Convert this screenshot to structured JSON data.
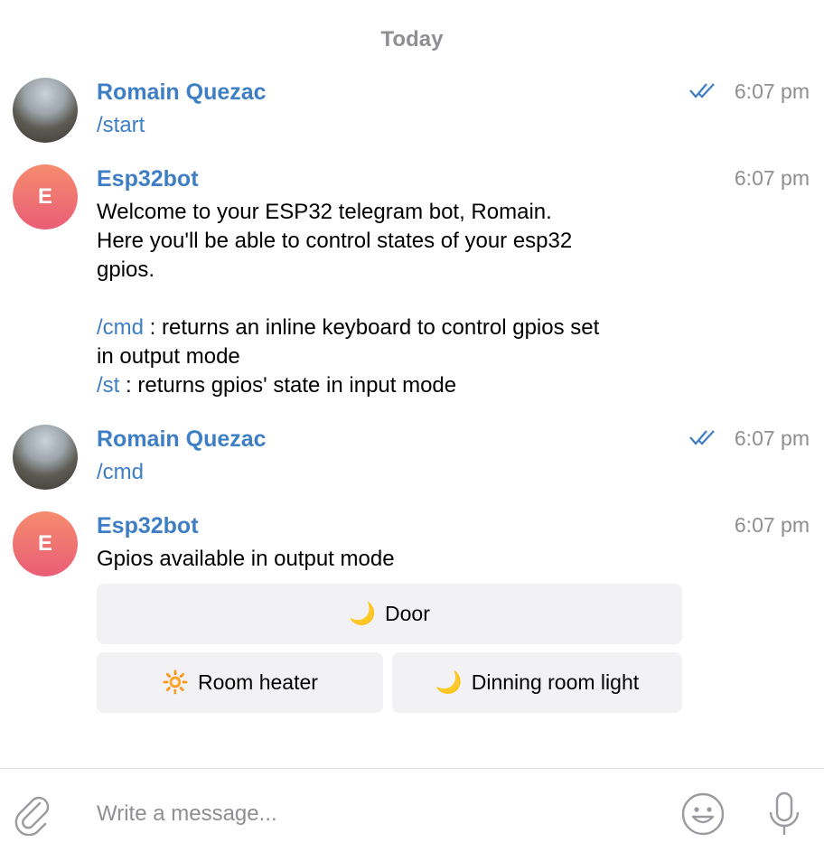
{
  "date_separator": "Today",
  "messages": [
    {
      "sender": "Romain Quezac",
      "time": "6:07 pm",
      "text": "/start"
    },
    {
      "sender": "Esp32bot",
      "avatar_letter": "E",
      "time": "6:07 pm",
      "line1": "Welcome to your ESP32 telegram bot, Romain.",
      "line2": "Here you'll be able to control states of your esp32",
      "line3": "gpios.",
      "cmd1": "/cmd",
      "cmd1_desc": " : returns an inline keyboard to control gpios set",
      "cmd1_desc2": "in output mode",
      "cmd2": "/st",
      "cmd2_desc": " : returns gpios' state in input mode"
    },
    {
      "sender": "Romain Quezac",
      "time": "6:07 pm",
      "text": "/cmd"
    },
    {
      "sender": "Esp32bot",
      "avatar_letter": "E",
      "time": "6:07 pm",
      "text": "Gpios available in output mode"
    }
  ],
  "keyboard": [
    {
      "emoji": "🌙",
      "label": "Door"
    },
    {
      "emoji": "🔆",
      "label": "Room heater"
    },
    {
      "emoji": "🌙",
      "label": "Dinning room light"
    }
  ],
  "composer": {
    "placeholder": "Write a message..."
  },
  "colors": {
    "link": "#3d7ec5",
    "muted": "#8e8e93",
    "button_bg": "#f2f2f4"
  }
}
